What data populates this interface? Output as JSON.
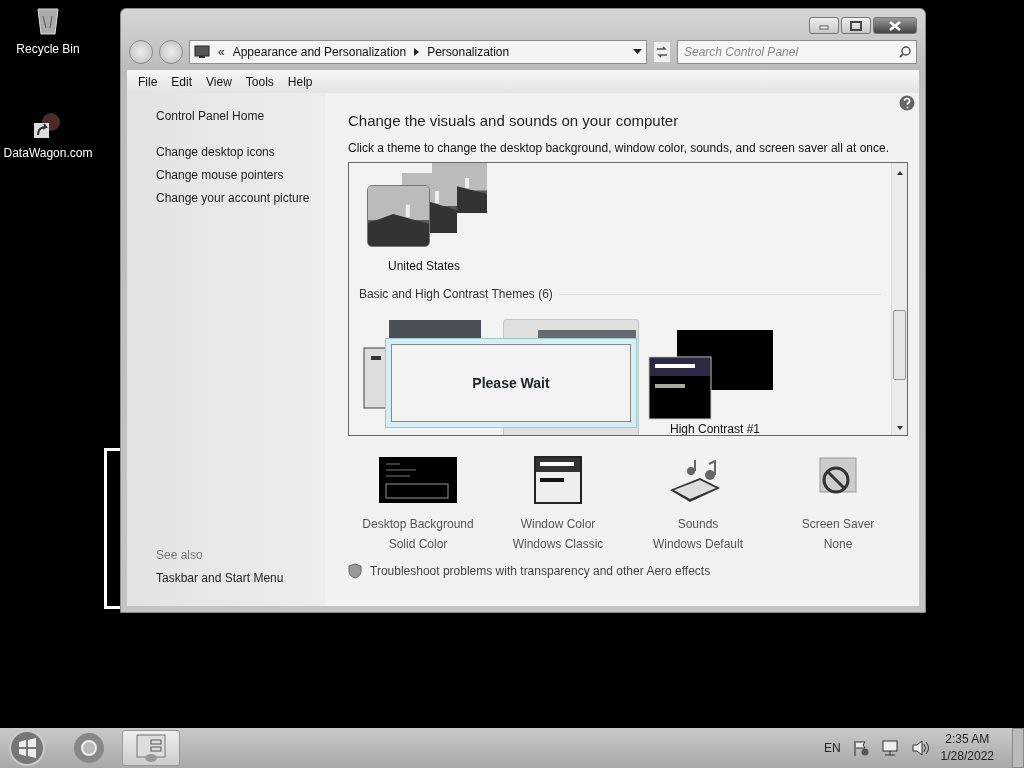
{
  "desktop_icons": [
    {
      "label": "Recycle Bin",
      "kind": "bin"
    },
    {
      "label": "DataWagon.com",
      "kind": "shortcut"
    }
  ],
  "window": {
    "address": {
      "overflow": "«",
      "crumbs": [
        "Appearance and Personalization",
        "Personalization"
      ]
    },
    "search": {
      "placeholder": "Search Control Panel"
    },
    "menu": [
      "File",
      "Edit",
      "View",
      "Tools",
      "Help"
    ]
  },
  "sidebar": {
    "links": [
      "Control Panel Home",
      "Change desktop icons",
      "Change mouse pointers",
      "Change your account picture"
    ],
    "see_also_title": "See also",
    "see_also": [
      "Taskbar and Start Menu"
    ]
  },
  "main": {
    "heading": "Change the visuals and sounds on your computer",
    "intro": "Click a theme to change the desktop background, window color, sounds, and screen saver all at once.",
    "my_themes": [
      {
        "label": "United States"
      }
    ],
    "basic_group": "Basic and High Contrast Themes (6)",
    "basic_themes": [
      {
        "kind": "basic",
        "selected": false
      },
      {
        "kind": "classic",
        "selected": true
      },
      {
        "kind": "contrast",
        "label": "High Contrast #1",
        "selected": false
      }
    ],
    "settings": [
      {
        "kind": "background",
        "title": "Desktop Background",
        "value": "Solid Color"
      },
      {
        "kind": "color",
        "title": "Window Color",
        "value": "Windows Classic"
      },
      {
        "kind": "sounds",
        "title": "Sounds",
        "value": "Windows Default"
      },
      {
        "kind": "saver",
        "title": "Screen Saver",
        "value": "None"
      }
    ],
    "troubleshoot": "Troubleshoot problems with transparency and other Aero effects"
  },
  "dialog": {
    "message": "Please Wait"
  },
  "taskbar": {
    "language": "EN",
    "time": "2:35 AM",
    "date": "1/28/2022"
  }
}
